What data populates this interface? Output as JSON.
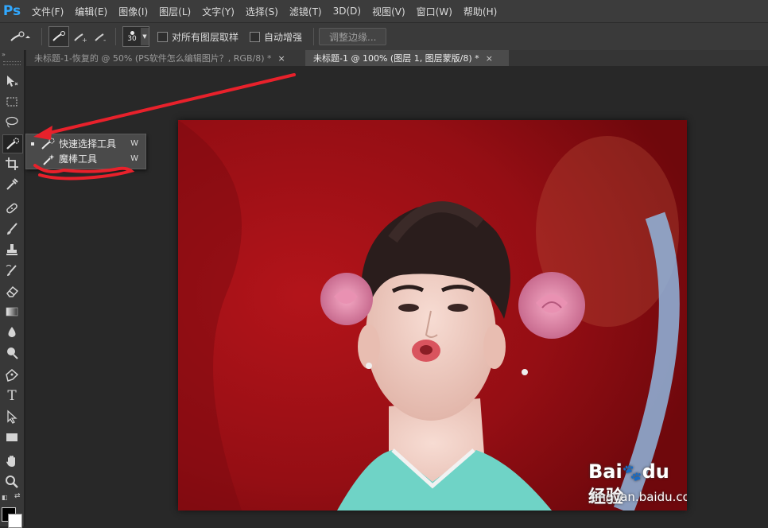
{
  "app": {
    "logo": "Ps"
  },
  "menu": [
    "文件(F)",
    "编辑(E)",
    "图像(I)",
    "图层(L)",
    "文字(Y)",
    "选择(S)",
    "滤镜(T)",
    "3D(D)",
    "视图(V)",
    "窗口(W)",
    "帮助(H)"
  ],
  "options": {
    "brush_size": "30",
    "sample_all_layers": "对所有图层取样",
    "auto_enhance": "自动增强",
    "refine_edge": "调整边缘..."
  },
  "tabs": [
    {
      "label": "未标题-1-恢复的 @ 50% (PS软件怎么编辑图片？, RGB/8) *",
      "close": "×",
      "active": false
    },
    {
      "label": "未标题-1 @ 100% (图层 1, 图层蒙版/8) *",
      "close": "×",
      "active": true
    }
  ],
  "flyout": [
    {
      "label": "快速选择工具",
      "shortcut": "W",
      "selected": true,
      "icon": "quick-selection-icon"
    },
    {
      "label": "魔棒工具",
      "shortcut": "W",
      "selected": false,
      "icon": "magic-wand-icon"
    }
  ],
  "watermark": {
    "brand_a": "Bai",
    "brand_b": "du",
    "brand_cn": "经验",
    "url": "jingyan.baidu.com"
  },
  "colors": {
    "accent": "#31a8ff",
    "annotation": "#e8212b",
    "canvas_bg": "#8e0d12"
  }
}
